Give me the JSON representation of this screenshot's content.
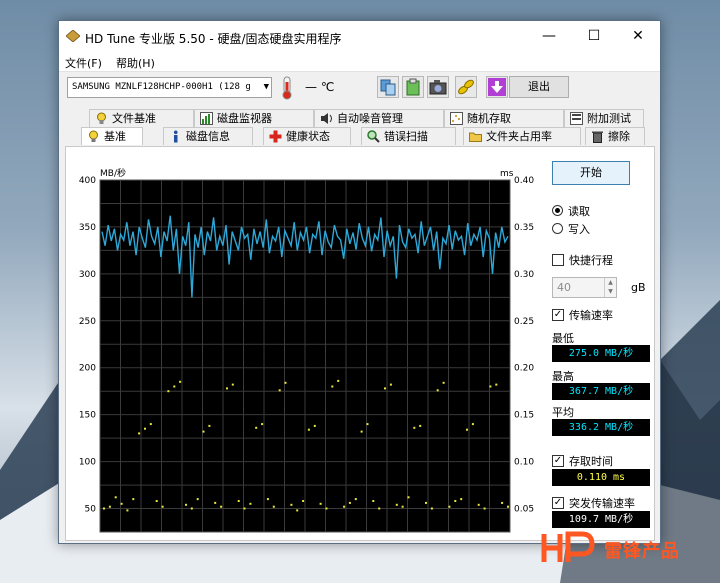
{
  "window": {
    "title": "HD Tune 专业版 5.50 - 硬盘/固态硬盘实用程序",
    "minimize": "—",
    "maximize": "☐",
    "close": "✕"
  },
  "menu": [
    {
      "label": "文件(F)"
    },
    {
      "label": "帮助(H)"
    }
  ],
  "toolbar": {
    "drive": "SAMSUNG MZNLF128HCHP-000H1 (128 g",
    "temperature": "— ℃",
    "exit_label": "退出"
  },
  "tabs_top": [
    {
      "label": "文件基准"
    },
    {
      "label": "磁盘监视器"
    },
    {
      "label": "自动噪音管理"
    },
    {
      "label": "随机存取"
    },
    {
      "label": "附加测试"
    }
  ],
  "tabs_bottom": [
    {
      "label": "基准"
    },
    {
      "label": "磁盘信息"
    },
    {
      "label": "健康状态"
    },
    {
      "label": "错误扫描"
    },
    {
      "label": "文件夹占用率"
    },
    {
      "label": "擦除"
    }
  ],
  "chart_data": {
    "type": "line",
    "left_axis": {
      "label": "MB/秒",
      "ticks": [
        50,
        100,
        150,
        200,
        250,
        300,
        350,
        400
      ],
      "ylim": [
        25,
        400
      ]
    },
    "right_axis": {
      "label": "ms",
      "ticks": [
        "0.05",
        "0.10",
        "0.15",
        "0.20",
        "0.25",
        "0.30",
        "0.35",
        "0.40"
      ],
      "ylim": [
        0.025,
        0.4
      ]
    },
    "grid": true,
    "series": [
      {
        "values": [
          345,
          330,
          352,
          335,
          348,
          325,
          342,
          336,
          355,
          330,
          345,
          320,
          350,
          338,
          328,
          358,
          340,
          332,
          350,
          318,
          345,
          335,
          362,
          325,
          348,
          300,
          340,
          330,
          355,
          275,
          342,
          328,
          350,
          320,
          345,
          335,
          360,
          325,
          340,
          330,
          352,
          310,
          345,
          335,
          325,
          350,
          338,
          342,
          315,
          348,
          332,
          345,
          328,
          358,
          322,
          340,
          335,
          350,
          318,
          346,
          338,
          330,
          355,
          325,
          344,
          336,
          350,
          322,
          342,
          338,
          356,
          320,
          346,
          334,
          328,
          352,
          340,
          336,
          316,
          348,
          332,
          344,
          326,
          354,
          338,
          330,
          350,
          324,
          342,
          336,
          360,
          318,
          346,
          330,
          340,
          295,
          352,
          334,
          328,
          348,
          338,
          342,
          322,
          356,
          330,
          340,
          350,
          325,
          345,
          305,
          338,
          332,
          352,
          326,
          346,
          336,
          340,
          320,
          354,
          330,
          342,
          336,
          350,
          318,
          346,
          338,
          300,
          344,
          328,
          350,
          334,
          340
        ]
      },
      {
        "values": [
          50,
          52,
          62,
          55,
          48,
          60,
          130,
          135,
          140,
          58,
          52,
          175,
          180,
          185,
          54,
          50,
          60,
          132,
          138,
          56,
          52,
          178,
          182,
          58,
          50,
          55,
          136,
          140,
          60,
          52,
          176,
          184,
          54,
          48,
          58,
          134,
          138,
          55,
          50,
          180,
          186,
          52,
          56,
          60,
          132,
          140,
          58,
          50,
          178,
          182,
          54,
          52,
          62,
          136,
          138,
          56,
          50,
          176,
          184,
          52,
          58,
          60,
          134,
          140,
          54,
          50,
          180,
          182,
          56,
          52
        ]
      }
    ]
  },
  "side": {
    "start_label": "开始",
    "read_label": "读取",
    "write_label": "写入",
    "short_stroke_label": "快捷行程",
    "short_stroke_value": "40",
    "short_stroke_unit": "gB",
    "transfer_rate_label": "传输速率",
    "min_label": "最低",
    "min_value": "275.0 MB/秒",
    "max_label": "最高",
    "max_value": "367.7 MB/秒",
    "avg_label": "平均",
    "avg_value": "336.2 MB/秒",
    "access_time_label": "存取时间",
    "access_time_value": "0.110 ms",
    "burst_rate_label": "突发传输速率",
    "burst_rate_value": "109.7 MB/秒"
  },
  "watermark": {
    "text": "雷锋产品"
  }
}
